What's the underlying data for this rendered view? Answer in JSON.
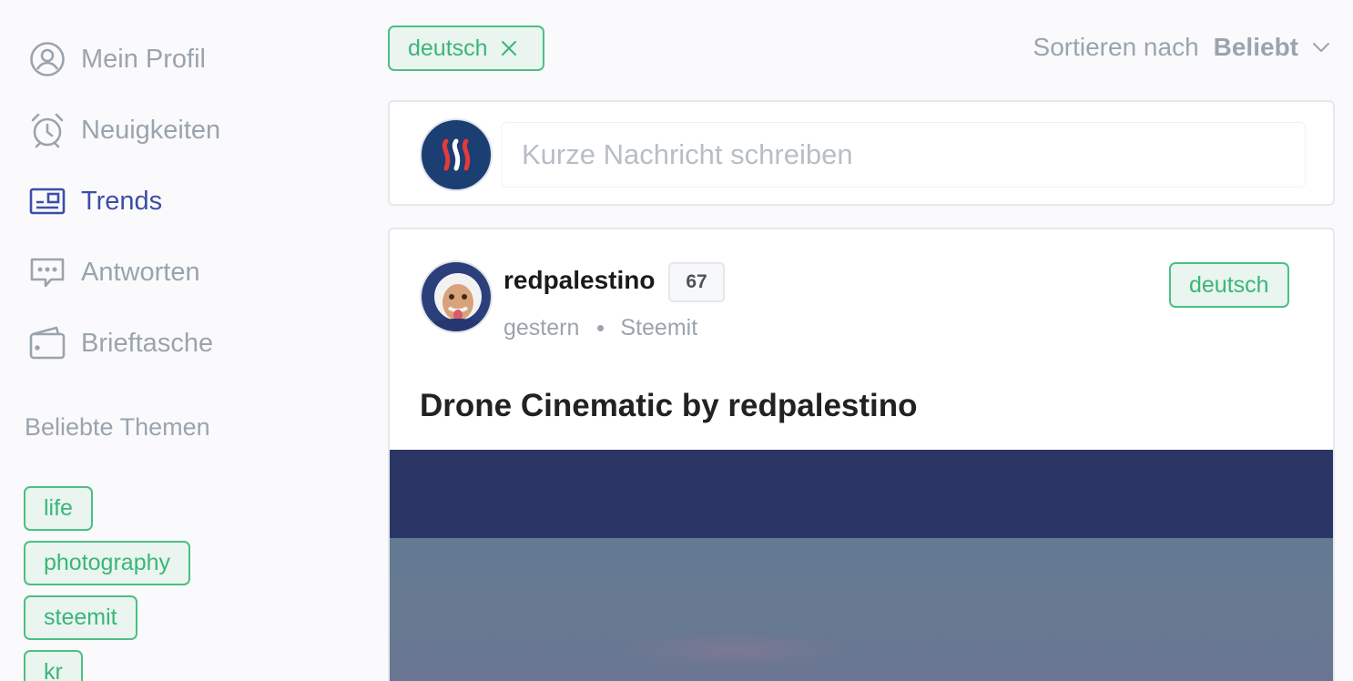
{
  "sidebar": {
    "items": [
      {
        "label": "Mein Profil",
        "icon": "user-circle-icon",
        "active": false
      },
      {
        "label": "Neuigkeiten",
        "icon": "alarm-clock-icon",
        "active": false
      },
      {
        "label": "Trends",
        "icon": "trends-icon",
        "active": true
      },
      {
        "label": "Antworten",
        "icon": "chat-bubble-icon",
        "active": false
      },
      {
        "label": "Brieftasche",
        "icon": "wallet-icon",
        "active": false
      }
    ],
    "topics_heading": "Beliebte Themen",
    "topics": [
      "life",
      "photography",
      "steemit",
      "kr"
    ]
  },
  "filter": {
    "tag": "deutsch"
  },
  "sort": {
    "prefix": "Sortieren nach",
    "value": "Beliebt"
  },
  "composer": {
    "placeholder": "Kurze Nachricht schreiben"
  },
  "post": {
    "author": "redpalestino",
    "reputation": "67",
    "time": "gestern",
    "app": "Steemit",
    "tag": "deutsch",
    "title": "Drone Cinematic by redpalestino"
  },
  "colors": {
    "accent_green": "#3bb57a",
    "active_nav": "#3d4ea6",
    "muted_text": "#9aa4ae",
    "steem_blue": "#1b3e73"
  }
}
